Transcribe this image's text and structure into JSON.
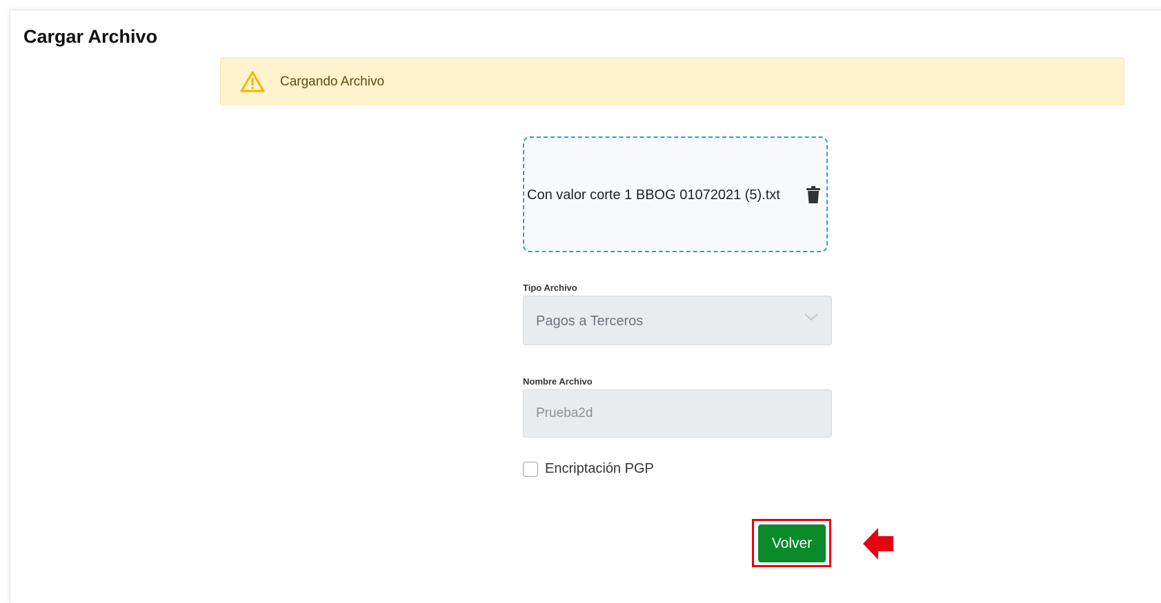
{
  "page": {
    "title": "Cargar Archivo"
  },
  "alert": {
    "message": "Cargando Archivo",
    "icon": "warning-triangle-icon",
    "color": "#fff3cd"
  },
  "dropzone": {
    "file_name": "Con valor corte 1 BBOG 01072021 (5).txt",
    "icon": "trash-icon",
    "border_color": "#1ea7d6"
  },
  "form": {
    "tipo_archivo": {
      "label": "Tipo Archivo",
      "value": "Pagos a Terceros"
    },
    "nombre_archivo": {
      "label": "Nombre Archivo",
      "value": "Prueba2d"
    },
    "encriptacion": {
      "label": "Encriptación PGP",
      "checked": false
    }
  },
  "actions": {
    "volver_label": "Volver",
    "button_color": "#0a8a2a",
    "highlight_color": "#e60012"
  }
}
